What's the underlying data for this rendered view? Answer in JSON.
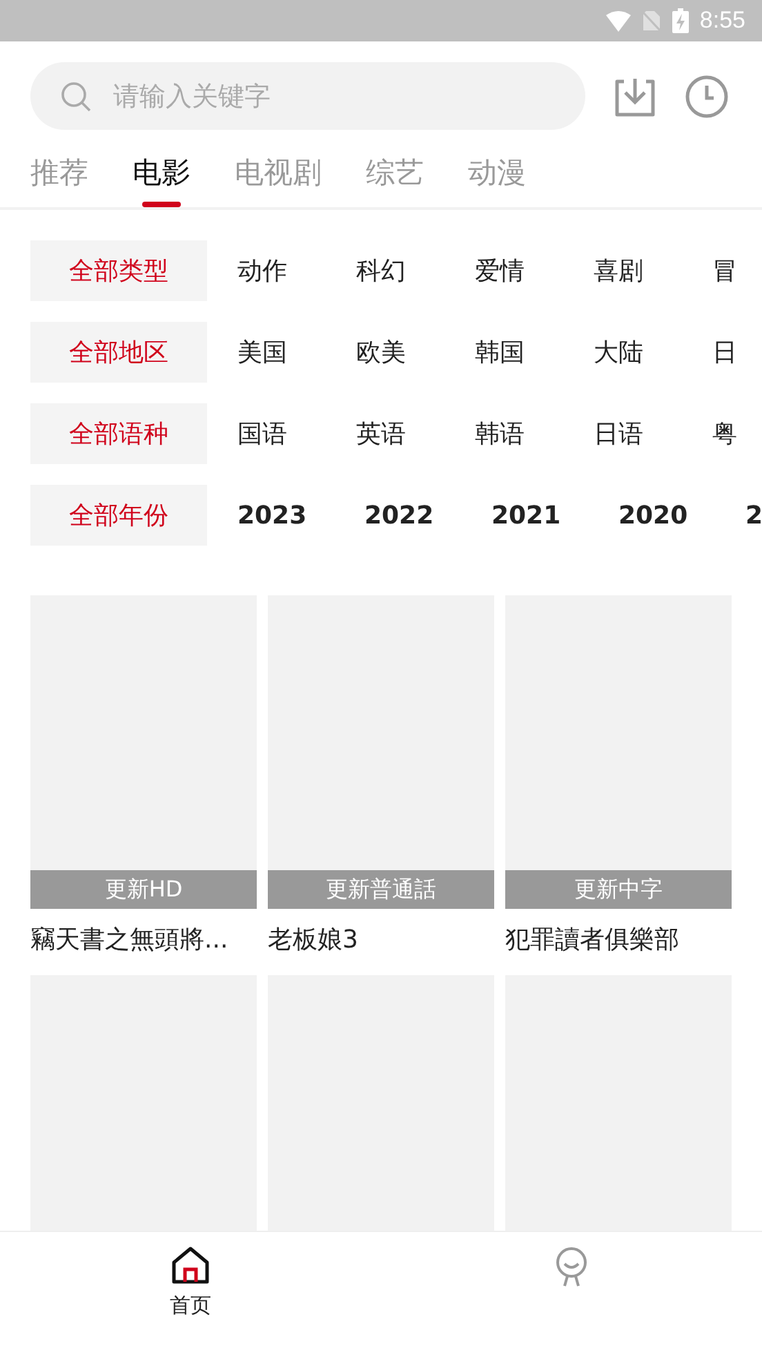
{
  "status_bar": {
    "time": "8:55"
  },
  "search": {
    "placeholder": "请输入关键字"
  },
  "tabs": [
    {
      "label": "推荐",
      "selected": false
    },
    {
      "label": "电影",
      "selected": true
    },
    {
      "label": "电视剧",
      "selected": false
    },
    {
      "label": "综艺",
      "selected": false
    },
    {
      "label": "动漫",
      "selected": false
    }
  ],
  "filters": [
    {
      "kind": "text",
      "options": [
        {
          "label": "全部类型",
          "selected": true
        },
        {
          "label": "动作",
          "selected": false
        },
        {
          "label": "科幻",
          "selected": false
        },
        {
          "label": "爱情",
          "selected": false
        },
        {
          "label": "喜剧",
          "selected": false
        },
        {
          "label": "冒",
          "selected": false
        }
      ]
    },
    {
      "kind": "text",
      "options": [
        {
          "label": "全部地区",
          "selected": true
        },
        {
          "label": "美国",
          "selected": false
        },
        {
          "label": "欧美",
          "selected": false
        },
        {
          "label": "韩国",
          "selected": false
        },
        {
          "label": "大陆",
          "selected": false
        },
        {
          "label": "日",
          "selected": false
        }
      ]
    },
    {
      "kind": "text",
      "options": [
        {
          "label": "全部语种",
          "selected": true
        },
        {
          "label": "国语",
          "selected": false
        },
        {
          "label": "英语",
          "selected": false
        },
        {
          "label": "韩语",
          "selected": false
        },
        {
          "label": "日语",
          "selected": false
        },
        {
          "label": "粤",
          "selected": false
        }
      ]
    },
    {
      "kind": "year",
      "options": [
        {
          "label": "全部年份",
          "selected": true
        },
        {
          "label": "2023",
          "selected": false
        },
        {
          "label": "2022",
          "selected": false
        },
        {
          "label": "2021",
          "selected": false
        },
        {
          "label": "2020",
          "selected": false
        },
        {
          "label": "2",
          "selected": false
        }
      ]
    }
  ],
  "movies": [
    {
      "kind": "poster",
      "badge": "更新HD",
      "title": "竊天書之無頭將..."
    },
    {
      "kind": "poster",
      "badge": "更新普通話",
      "title": "老板娘3"
    },
    {
      "kind": "poster",
      "badge": "更新中字",
      "title": "犯罪讀者俱樂部"
    },
    {
      "kind": "blank"
    },
    {
      "kind": "blank"
    },
    {
      "kind": "blank"
    }
  ],
  "bottom_nav": [
    {
      "kind": "home",
      "label": "首页",
      "selected": true
    },
    {
      "kind": "profile",
      "selected": false
    }
  ]
}
